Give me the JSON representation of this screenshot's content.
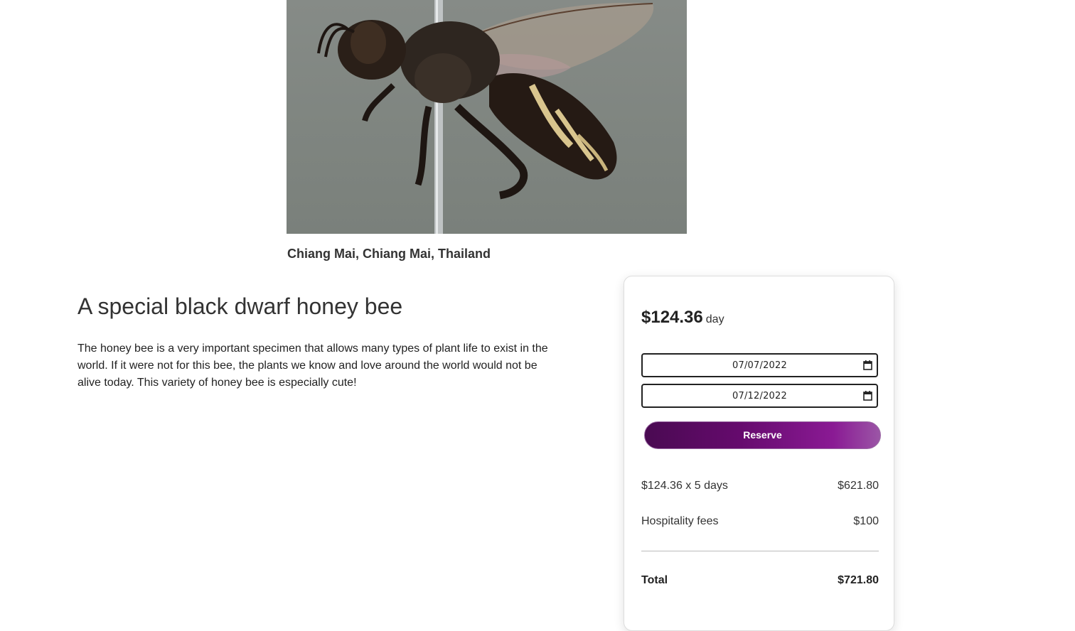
{
  "listing": {
    "location": "Chiang Mai, Chiang Mai, Thailand",
    "title": "A special black dwarf honey bee",
    "description": "The honey bee is a very important specimen that allows many types of plant life to exist in the world. If it were not for this bee, the plants we know and love around the world would not be alive today. This variety of honey bee is especially cute!",
    "photo_icon": "honey-bee-photo"
  },
  "booking": {
    "price": "$124.36",
    "per_unit": "day",
    "check_in": "07/07/2022",
    "check_out": "07/12/2022",
    "reserve_label": "Reserve",
    "reserve_gradient": [
      "#4a0a52",
      "#650a6d",
      "#8a1a94",
      "#9b56a6"
    ],
    "line_items": [
      {
        "label": "$124.36 x 5 days",
        "amount": "$621.80"
      },
      {
        "label": "Hospitality fees",
        "amount": "$100"
      }
    ],
    "total_label": "Total",
    "total_amount": "$721.80"
  }
}
